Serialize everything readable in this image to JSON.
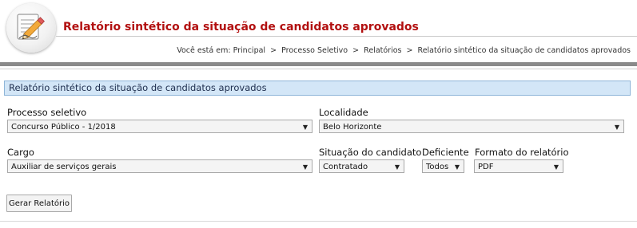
{
  "header": {
    "title": "Relatório sintético da situação de candidatos aprovados",
    "logo_icon": "edit-document-icon",
    "breadcrumb": {
      "prefix": "Você está em:",
      "items": [
        "Principal",
        "Processo Seletivo",
        "Relatórios",
        "Relatório sintético da situação de candidatos aprovados"
      ],
      "separator": ">"
    }
  },
  "panel": {
    "title": "Relatório sintético da situação de candidatos aprovados"
  },
  "form": {
    "processo": {
      "label": "Processo seletivo",
      "value": "Concurso Público - 1/2018"
    },
    "localidade": {
      "label": "Localidade",
      "value": "Belo Horizonte"
    },
    "cargo": {
      "label": "Cargo",
      "value": "Auxiliar de serviços gerais"
    },
    "situacao": {
      "label": "Situação do candidato",
      "value": "Contratado"
    },
    "deficiente": {
      "label": "Deficiente",
      "value": "Todos"
    },
    "formato": {
      "label": "Formato do relatório",
      "value": "PDF"
    },
    "submit_label": "Gerar Relatório",
    "dropdown_arrow": "▼"
  },
  "colors": {
    "title": "#b21010",
    "panel_bg": "#d3e6f7",
    "panel_border": "#8fb5d8",
    "divider": "#8a8a8a"
  }
}
